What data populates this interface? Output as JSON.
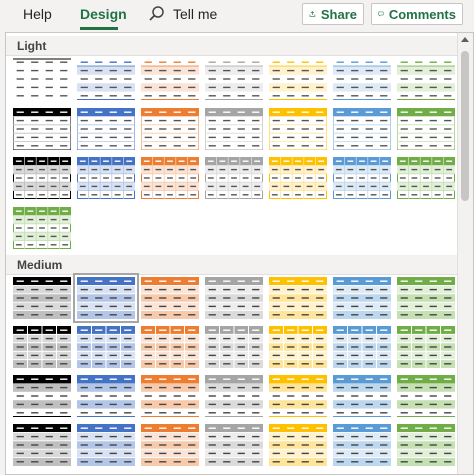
{
  "ribbon": {
    "tabs": [
      {
        "label": "Help",
        "active": false
      },
      {
        "label": "Design",
        "active": true
      }
    ],
    "search_label": "Tell me",
    "share_label": "Share",
    "comments_label": "Comments",
    "accent_color": "#217346"
  },
  "gallery": {
    "sections": [
      {
        "label": "Light"
      },
      {
        "label": "Medium"
      }
    ],
    "color_themes": [
      {
        "name": "none",
        "dark": "#000000",
        "light": "#d9d9d9",
        "mid": "#bfbfbf"
      },
      {
        "name": "blue",
        "dark": "#4472c4",
        "light": "#d9e2f3",
        "mid": "#b4c6e7"
      },
      {
        "name": "orange",
        "dark": "#ed7d31",
        "light": "#fbe4d5",
        "mid": "#f7caac"
      },
      {
        "name": "gray",
        "dark": "#a5a5a5",
        "light": "#ededed",
        "mid": "#dbdbdb"
      },
      {
        "name": "gold",
        "dark": "#ffc000",
        "light": "#fff2cc",
        "mid": "#ffe599"
      },
      {
        "name": "darkblue",
        "dark": "#5b9bd5",
        "light": "#deebf6",
        "mid": "#bdd7ee"
      },
      {
        "name": "green",
        "dark": "#70ad47",
        "light": "#e2efd9",
        "mid": "#c5e0b3"
      }
    ],
    "selected_style": "Medium 2"
  }
}
